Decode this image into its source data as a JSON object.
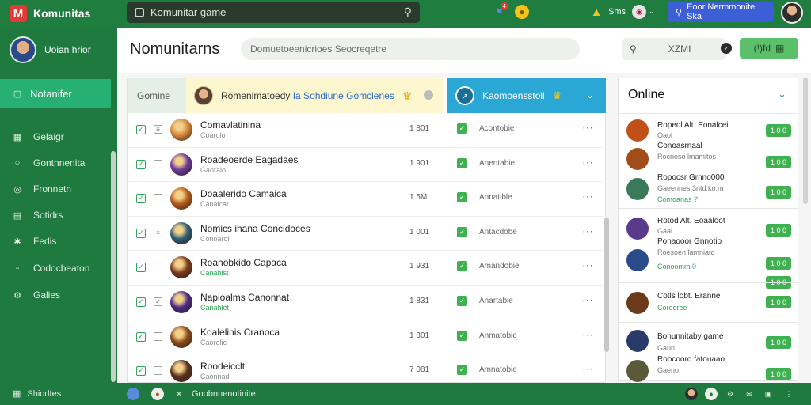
{
  "app": {
    "name": "Komunitas",
    "logo_letter": "M"
  },
  "topbar": {
    "search_text": "Komunitar game",
    "notification_badge": "4",
    "user_label": "Sms",
    "primary_button": "Eoor Nermmonite Ska"
  },
  "sidebar": {
    "profile_name": "Uoian hrior",
    "active_item": "Notanifer",
    "items": [
      "Gelaigr",
      "Gontnnenita",
      "Fronnetn",
      "Sotidrs",
      "Fedis",
      "Codocbeaton",
      "Galies"
    ]
  },
  "main": {
    "title": "Nomunitarns",
    "search_placeholder": "Domuetoeenicrioes Seocreqetre",
    "filter_value": "XZMI",
    "action_label": "(!)fd"
  },
  "list": {
    "tab_label": "Gomine",
    "banner_text": "Romenimatoedy",
    "banner_highlight": "Ia Sohdiune Gomclenes",
    "blue_banner": "Kaomoensstoll",
    "rows": [
      {
        "name": "Comavlatinina",
        "sub": "Coarolo",
        "sub_green": false,
        "num": "1 801",
        "status": "Acontobie",
        "avatar": "#d8883a"
      },
      {
        "name": "Roadeoerde Eagadaes",
        "sub": "Gaoralo",
        "sub_green": false,
        "num": "1 901",
        "status": "Anentabie",
        "avatar": "#6b3a9e"
      },
      {
        "name": "Doaalerido Camaica",
        "sub": "Canaicat",
        "sub_green": false,
        "num": "1 5M",
        "status": "Annatible",
        "avatar": "#b55b1c"
      },
      {
        "name": "Nomics ihana Concldoces",
        "sub": "Conoarol",
        "sub_green": false,
        "num": "1 001",
        "status": "Antacdobe",
        "avatar": "#2f5f7a"
      },
      {
        "name": "Roanobkido Capaca",
        "sub": "Canahlst",
        "sub_green": true,
        "num": "1 931",
        "status": "Amandobie",
        "avatar": "#7a3a1a"
      },
      {
        "name": "Napioalms Canonnat",
        "sub": "Canahlet",
        "sub_green": true,
        "num": "1 831",
        "status": "Anartabie",
        "avatar": "#4a2a8a"
      },
      {
        "name": "Koalelinis Cranoca",
        "sub": "Caorelic",
        "sub_green": false,
        "num": "1 801",
        "status": "Anmatobie",
        "avatar": "#8a4a1a"
      },
      {
        "name": "Roodeicclt",
        "sub": "Caonnad",
        "sub_green": false,
        "num": "7 081",
        "status": "Amnatobie",
        "avatar": "#5a3020"
      }
    ]
  },
  "online": {
    "title": "Online",
    "groups": [
      {
        "lines": [
          {
            "text": "Ropeol Alt. Eonalcei",
            "sub": "Oaol",
            "sub_green": false,
            "btn": "1 0 0",
            "avatar": "#c0501a"
          },
          {
            "text": "Conoasrnaal",
            "sub": "Rocnoso lmamitos",
            "sub_green": false,
            "btn": "1 0 0",
            "avatar": "#a04d1a"
          },
          {
            "text": "Ropocsr Grnno000",
            "sub": "Gaeennes 3ntd.ko.m",
            "sub_green": false,
            "btn": "1 0 0",
            "avatar": "#3a7a5a"
          },
          {
            "text": "Comoanas ?",
            "sub": "",
            "sub_green": true,
            "btn": "",
            "avatar": ""
          }
        ]
      },
      {
        "lines": [
          {
            "text": "Rotod Alt. Eoaaloot",
            "sub": "Gaal",
            "sub_green": false,
            "btn": "1 0 0",
            "avatar": "#5a3a8a"
          },
          {
            "text": "Ponaooor Gnnotio",
            "sub": "Roesoen lamniato",
            "sub_green": false,
            "btn": "1 0 0",
            "avatar": "#2a4a8a"
          },
          {
            "text": "Conoomm 0",
            "sub": "",
            "sub_green": true,
            "btn": "1 0 0",
            "avatar": ""
          }
        ]
      },
      {
        "lines": [
          {
            "text": "Cotls lobt. Eranne",
            "sub": "Corooree",
            "sub_green": true,
            "btn": "1 0 0",
            "avatar": "#6a3a1a"
          }
        ]
      },
      {
        "lines": [
          {
            "text": "Bonunnitaby game",
            "sub": "Gaun",
            "sub_green": false,
            "btn": "1 0 0",
            "avatar": "#2a3a6a"
          },
          {
            "text": "Roocooro fatouaao",
            "sub": "Gaeno",
            "sub_green": false,
            "btn": "1 0 0",
            "avatar": "#5a5a3a"
          }
        ]
      }
    ]
  },
  "bottombar": {
    "left_text": "Shiodtes",
    "center_text": "Goobnnenotinite"
  }
}
